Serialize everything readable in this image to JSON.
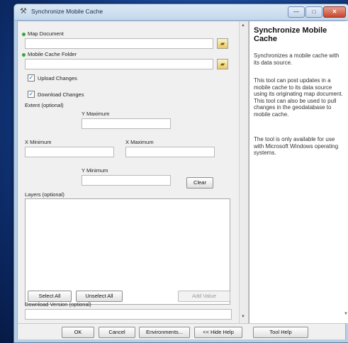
{
  "window": {
    "title": "Synchronize Mobile Cache",
    "minimize": "—",
    "maximize": "□",
    "close": "✕"
  },
  "form": {
    "map_document_label": "Map Document",
    "mobile_cache_folder_label": "Mobile Cache Folder",
    "upload_changes_label": "Upload Changes",
    "upload_changes_checked": true,
    "download_changes_label": "Download Changes",
    "download_changes_checked": true,
    "extent_label": "Extent (optional)",
    "y_maximum_label": "Y Maximum",
    "x_minimum_label": "X Minimum",
    "x_maximum_label": "X Maximum",
    "y_minimum_label": "Y Minimum",
    "clear_button": "Clear",
    "layers_label": "Layers (optional)",
    "select_all_button": "Select All",
    "unselect_all_button": "Unselect All",
    "add_value_button": "Add Value",
    "download_version_label": "Download Version (optional)"
  },
  "help": {
    "title": "Synchronize Mobile Cache",
    "paragraphs": [
      "Synchronizes a mobile cache with its data source.",
      "This tool can post updates in a mobile cache to its data source using its originating map document. This tool can also be used to pull changes in the geodatabase to mobile cache.",
      "The tool is only available for use with Microsoft Windows operating systems."
    ]
  },
  "footer": {
    "ok": "OK",
    "cancel": "Cancel",
    "environments": "Environments...",
    "hide_help": "<< Hide Help",
    "tool_help": "Tool Help"
  },
  "icons": {
    "title": "tool-icon",
    "folder": "open-folder-icon",
    "required": "green-dot-icon"
  }
}
